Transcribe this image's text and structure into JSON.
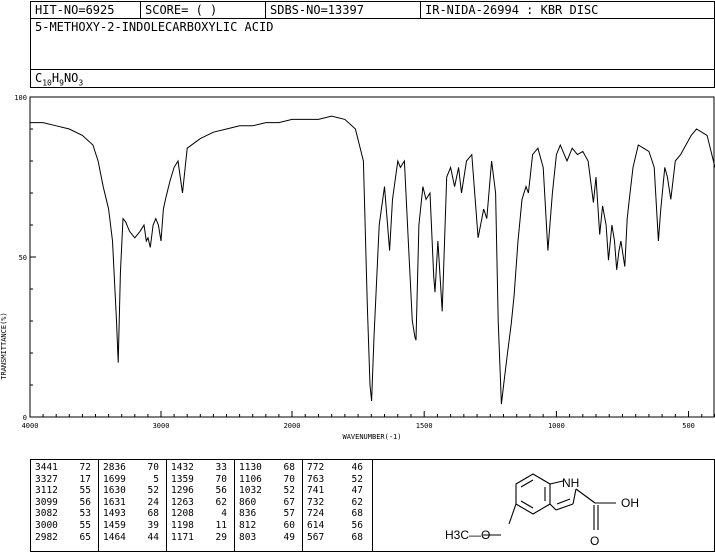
{
  "header": {
    "hit_no": "HIT-NO=6925",
    "score": "SCORE=  (   )",
    "sdbs_no": "SDBS-NO=13397",
    "ir_id": "IR-NIDA-26994 : KBR DISC",
    "compound_name": "5-METHOXY-2-INDOLECARBOXYLIC ACID",
    "formula": {
      "c": "C",
      "c_n": "10",
      "h": "H",
      "h_n": "9",
      "n": "N",
      "o": "O",
      "o_n": "3"
    }
  },
  "chart_data": {
    "type": "line",
    "title": "",
    "xlabel": "WAVENUMBER(-1)",
    "ylabel": "TRANSMITTANCE(%)",
    "xlim": [
      4000,
      400
    ],
    "ylim": [
      0,
      100
    ],
    "x_ticks": [
      "4000",
      "3000",
      "2000",
      "1500",
      "1000",
      "500"
    ],
    "y_ticks": [
      "100",
      "50",
      "0"
    ],
    "series": [
      {
        "x": [
          4000,
          3900,
          3800,
          3700,
          3600,
          3520,
          3480,
          3441,
          3400,
          3370,
          3340,
          3327,
          3310,
          3290,
          3270,
          3240,
          3200,
          3160,
          3130,
          3112,
          3099,
          3082,
          3060,
          3040,
          3020,
          3000,
          2982,
          2960,
          2930,
          2900,
          2870,
          2836,
          2800,
          2700,
          2600,
          2500,
          2400,
          2300,
          2200,
          2100,
          2000,
          1950,
          1900,
          1850,
          1800,
          1760,
          1730,
          1715,
          1705,
          1699,
          1690,
          1670,
          1650,
          1631,
          1620,
          1600,
          1590,
          1575,
          1560,
          1545,
          1535,
          1531,
          1520,
          1505,
          1493,
          1478,
          1464,
          1459,
          1448,
          1432,
          1415,
          1400,
          1385,
          1370,
          1359,
          1340,
          1320,
          1296,
          1275,
          1263,
          1245,
          1230,
          1220,
          1208,
          1198,
          1185,
          1171,
          1160,
          1145,
          1130,
          1115,
          1106,
          1090,
          1070,
          1050,
          1032,
          1015,
          1000,
          985,
          960,
          940,
          920,
          900,
          880,
          860,
          850,
          836,
          825,
          812,
          803,
          790,
          780,
          772,
          763,
          756,
          741,
          732,
          724,
          710,
          690,
          670,
          650,
          630,
          614,
          605,
          590,
          580,
          567,
          550,
          530,
          510,
          490,
          470,
          450,
          430,
          400
        ],
        "y": [
          92,
          92,
          91,
          90,
          88,
          85,
          80,
          72,
          65,
          55,
          30,
          17,
          45,
          62,
          61,
          58,
          56,
          58,
          60,
          55,
          56,
          53,
          60,
          62,
          60,
          55,
          65,
          69,
          74,
          78,
          80,
          70,
          84,
          87,
          89,
          90,
          91,
          91,
          92,
          92,
          93,
          93,
          93,
          94,
          93,
          90,
          80,
          35,
          10,
          5,
          25,
          60,
          72,
          52,
          68,
          80,
          78,
          80,
          55,
          30,
          25,
          24,
          60,
          72,
          68,
          70,
          44,
          39,
          55,
          33,
          75,
          78,
          72,
          78,
          70,
          80,
          82,
          56,
          65,
          62,
          80,
          70,
          30,
          4,
          11,
          20,
          29,
          38,
          55,
          68,
          72,
          70,
          82,
          84,
          78,
          52,
          70,
          82,
          85,
          80,
          84,
          82,
          83,
          80,
          67,
          75,
          57,
          66,
          60,
          49,
          60,
          55,
          46,
          52,
          55,
          47,
          62,
          68,
          78,
          85,
          84,
          83,
          78,
          55,
          65,
          78,
          75,
          68,
          80,
          82,
          85,
          88,
          90,
          89,
          88,
          78
        ],
        "color": "#000000"
      }
    ]
  },
  "peak_table": {
    "columns": [
      [
        [
          "3441",
          "72"
        ],
        [
          "3327",
          "17"
        ],
        [
          "3112",
          "55"
        ],
        [
          "3099",
          "56"
        ],
        [
          "3082",
          "53"
        ],
        [
          "3000",
          "55"
        ],
        [
          "2982",
          "65"
        ]
      ],
      [
        [
          "2836",
          "70"
        ],
        [
          "1699",
          "5"
        ],
        [
          "1630",
          "52"
        ],
        [
          "1631",
          "24"
        ],
        [
          "1493",
          "68"
        ],
        [
          "1459",
          "39"
        ],
        [
          "1464",
          "44"
        ]
      ],
      [
        [
          "1432",
          "33"
        ],
        [
          "1359",
          "70"
        ],
        [
          "1296",
          "56"
        ],
        [
          "1263",
          "62"
        ],
        [
          "1208",
          "4"
        ],
        [
          "1198",
          "11"
        ],
        [
          "1171",
          "29"
        ]
      ],
      [
        [
          "1130",
          "68"
        ],
        [
          "1106",
          "70"
        ],
        [
          "1032",
          "52"
        ],
        [
          "860",
          "67"
        ],
        [
          "836",
          "57"
        ],
        [
          "812",
          "60"
        ],
        [
          "803",
          "49"
        ]
      ],
      [
        [
          "772",
          "46"
        ],
        [
          "763",
          "52"
        ],
        [
          "741",
          "47"
        ],
        [
          "732",
          "62"
        ],
        [
          "724",
          "68"
        ],
        [
          "614",
          "56"
        ],
        [
          "567",
          "68"
        ]
      ]
    ]
  },
  "structure": {
    "labels": {
      "nh": "NH",
      "oh": "OH",
      "o_carbonyl": "O",
      "methoxy": "H3C—O"
    }
  }
}
